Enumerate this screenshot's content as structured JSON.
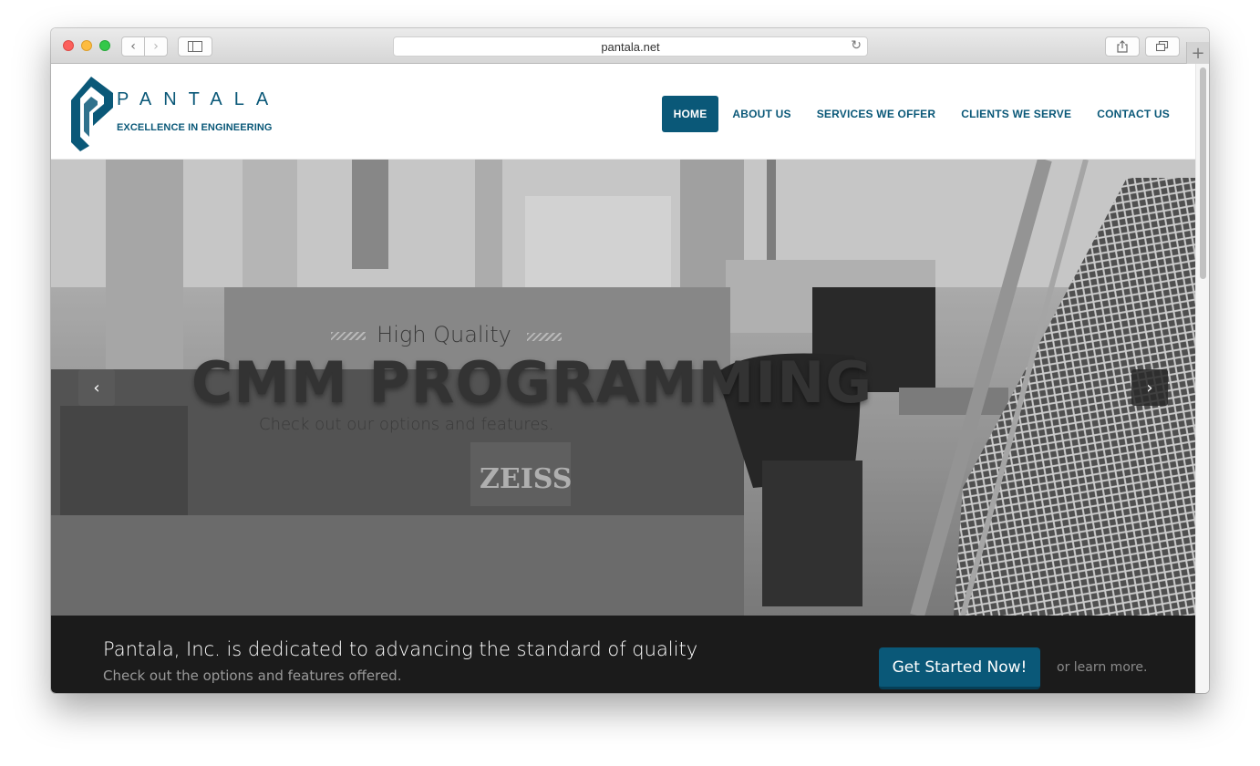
{
  "browser": {
    "url": "pantala.net",
    "back_icon": "chevron-left-icon",
    "forward_icon": "chevron-right-icon",
    "reload_icon": "reload-icon",
    "new_tab_label": "+"
  },
  "brand": {
    "name": "PANTALA",
    "tagline": "EXCELLENCE IN ENGINEERING",
    "color": "#0a5878"
  },
  "nav": {
    "items": [
      {
        "label": "HOME",
        "active": true
      },
      {
        "label": "ABOUT US",
        "active": false
      },
      {
        "label": "SERVICES WE OFFER",
        "active": false
      },
      {
        "label": "CLIENTS WE SERVE",
        "active": false
      },
      {
        "label": "CONTACT US",
        "active": false
      }
    ]
  },
  "hero": {
    "eyebrow": "High Quality",
    "title": "CMM PROGRAMMING",
    "subtitle": "Check out our options and features.",
    "prev_icon": "chevron-left-icon",
    "next_icon": "chevron-right-icon"
  },
  "cta": {
    "title": "Pantala, Inc. is dedicated to advancing the standard of quality",
    "subtitle": "Check out the options and features offered.",
    "button": "Get Started Now!",
    "link": "or learn more."
  }
}
